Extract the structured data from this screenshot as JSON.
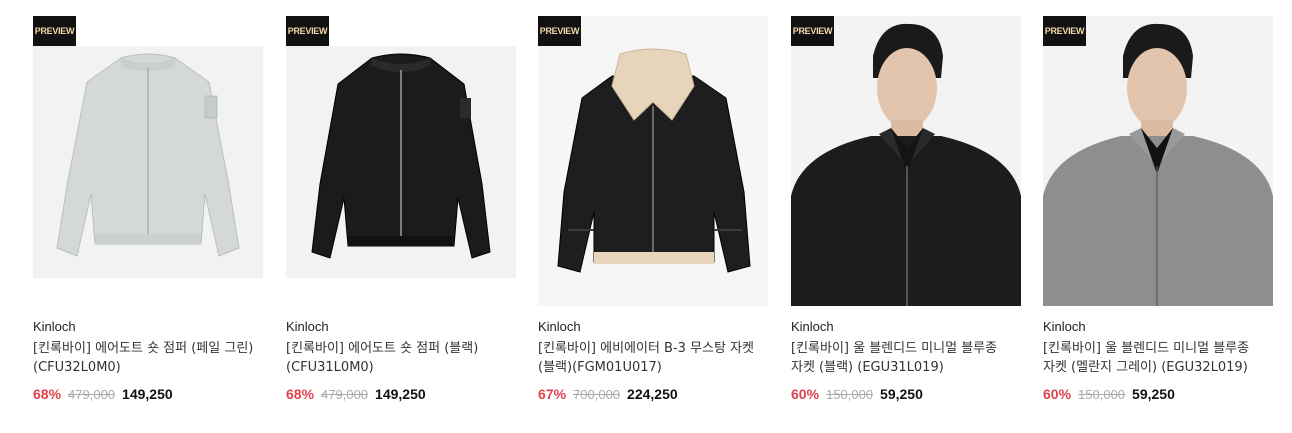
{
  "badge_label": "PREVIEW",
  "colors": {
    "discount": "#e0434b",
    "badge_bg": "#111111",
    "badge_text": "#f2d7a8",
    "thumb_bg": "#f4f4f4"
  },
  "products": [
    {
      "brand": "Kinloch",
      "name": "[킨록바이] 에어도트 숏 점퍼 (페일 그린)(CFU32L0M0)",
      "discount": "68%",
      "original_price": "479,000",
      "sale_price": "149,250",
      "image": "pale-green-bomber-jacket"
    },
    {
      "brand": "Kinloch",
      "name": "[킨록바이] 에어도트 숏 점퍼 (블랙)(CFU31L0M0)",
      "discount": "68%",
      "original_price": "479,000",
      "sale_price": "149,250",
      "image": "black-bomber-jacket"
    },
    {
      "brand": "Kinloch",
      "name": "[킨록바이] 에비에이터 B-3 무스탕 자켓 (블랙)(FGM01U017)",
      "discount": "67%",
      "original_price": "700,000",
      "sale_price": "224,250",
      "image": "black-shearling-aviator-jacket"
    },
    {
      "brand": "Kinloch",
      "name": "[킨록바이] 울 블렌디드 미니멀 블루종 자켓 (블랙) (EGU31L019)",
      "discount": "60%",
      "original_price": "150,000",
      "sale_price": "59,250",
      "image": "model-black-wool-blouson"
    },
    {
      "brand": "Kinloch",
      "name": "[킨록바이] 울 블렌디드 미니멀 블루종 자켓 (멜란지 그레이) (EGU32L019)",
      "discount": "60%",
      "original_price": "150,000",
      "sale_price": "59,250",
      "image": "model-grey-wool-blouson"
    }
  ]
}
